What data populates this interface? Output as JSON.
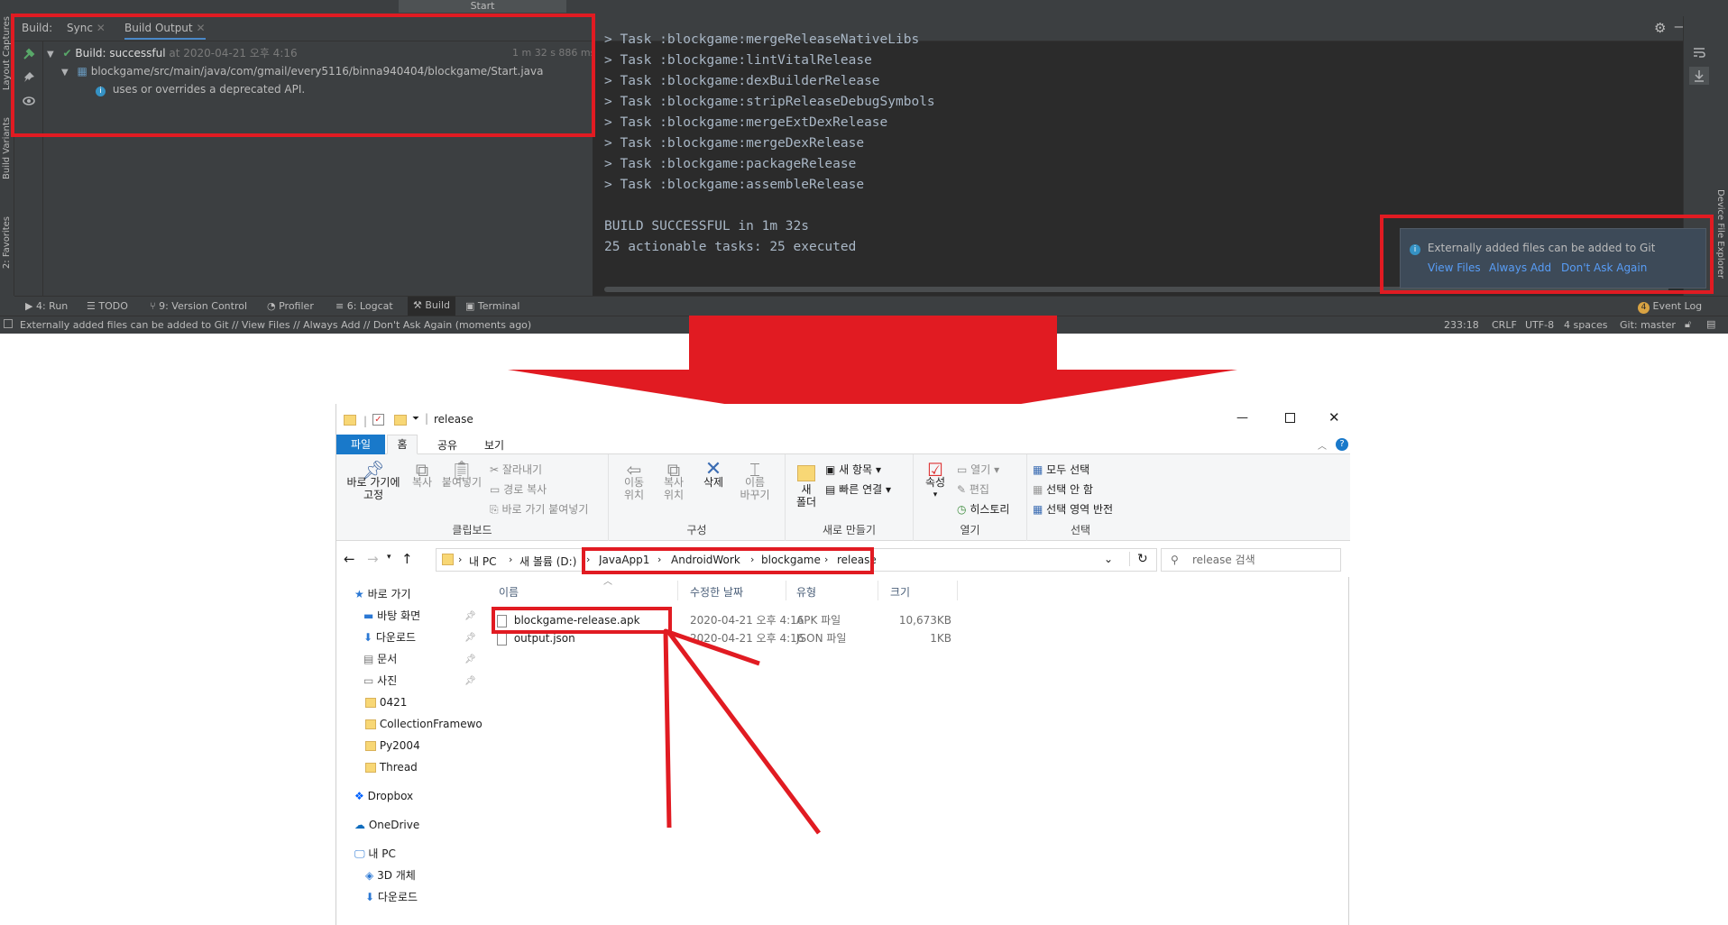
{
  "studio": {
    "start_tab": "Start",
    "left_strip": [
      "Layout Captures",
      "Build Variants",
      "2: Favorites"
    ],
    "right_strip": [
      "Device File Explorer"
    ],
    "build_header": {
      "label": "Build:",
      "tabs": [
        "Sync",
        "Build Output"
      ]
    },
    "tree": {
      "root_label": "Build:",
      "root_status": "successful",
      "root_time": "at 2020-04-21 오후 4:16",
      "duration": "1 m 32 s 886 ms",
      "file": "blockgame/src/main/java/com/gmail/every5116/binna940404/blockgame/Start.java",
      "warning": "uses or overrides a deprecated API."
    },
    "console_lines": [
      "> Task :blockgame:mergeReleaseNativeLibs",
      "> Task :blockgame:lintVitalRelease",
      "> Task :blockgame:dexBuilderRelease",
      "> Task :blockgame:stripReleaseDebugSymbols",
      "> Task :blockgame:mergeExtDexRelease",
      "> Task :blockgame:mergeDexRelease",
      "> Task :blockgame:packageRelease",
      "> Task :blockgame:assembleRelease",
      "",
      "BUILD SUCCESSFUL in 1m 32s",
      "25 actionable tasks: 25 executed"
    ],
    "notification": {
      "message": "Externally added files can be added to Git",
      "actions": [
        "View Files",
        "Always Add",
        "Don't Ask Again"
      ]
    },
    "bottom_tabs": [
      {
        "icon": "run-icon",
        "label": "4: Run"
      },
      {
        "icon": "todo-icon",
        "label": "TODO"
      },
      {
        "icon": "version-control-icon",
        "label": "9: Version Control"
      },
      {
        "icon": "profiler-icon",
        "label": "Profiler"
      },
      {
        "icon": "logcat-icon",
        "label": "6: Logcat"
      },
      {
        "icon": "build-hammer-icon",
        "label": "Build"
      },
      {
        "icon": "terminal-icon",
        "label": "Terminal"
      }
    ],
    "event_log": {
      "count": "4",
      "label": "Event Log"
    },
    "status": {
      "message": "Externally added files can be added to Git // View Files // Always Add // Don't Ask Again (moments ago)",
      "position": "233:18",
      "line_sep": "CRLF",
      "encoding": "UTF-8",
      "indent": "4 spaces",
      "vcs": "Git: master"
    }
  },
  "explorer": {
    "title": "release",
    "ribbon_tabs": [
      "파일",
      "홈",
      "공유",
      "보기"
    ],
    "clipboard": {
      "group": "클립보드",
      "pin_line1": "바로 가기에",
      "pin_line2": "고정",
      "copy": "복사",
      "paste": "붙여넣기",
      "cut": "잘라내기",
      "copy_path": "경로 복사",
      "paste_shortcut": "바로 가기 붙여넣기"
    },
    "organize": {
      "group": "구성",
      "move_l1": "이동",
      "move_l2": "위치",
      "copyto_l1": "복사",
      "copyto_l2": "위치",
      "delete": "삭제",
      "rename_l1": "이름",
      "rename_l2": "바꾸기"
    },
    "new": {
      "group": "새로 만들기",
      "folder_l1": "새",
      "folder_l2": "폴더",
      "new_item": "새 항목",
      "easy_access": "빠른 연결"
    },
    "open": {
      "group": "열기",
      "properties": "속성",
      "open": "열기",
      "edit": "편집",
      "history": "히스토리"
    },
    "select": {
      "group": "선택",
      "all": "모두 선택",
      "none": "선택 안 함",
      "invert": "선택 영역 반전"
    },
    "breadcrumb_pre": [
      "내 PC",
      "새 볼륨 (D:)"
    ],
    "breadcrumb": [
      "JavaApp1",
      "AndroidWork",
      "blockgame",
      "release"
    ],
    "search_placeholder": "release 검색",
    "nav": [
      {
        "icon": "star-icon",
        "label": "바로 가기",
        "pin": false,
        "indent": 0
      },
      {
        "icon": "desktop-icon",
        "label": "바탕 화면",
        "pin": true,
        "indent": 1
      },
      {
        "icon": "download-icon",
        "label": "다운로드",
        "pin": true,
        "indent": 1
      },
      {
        "icon": "document-icon",
        "label": "문서",
        "pin": true,
        "indent": 1
      },
      {
        "icon": "pictures-icon",
        "label": "사진",
        "pin": true,
        "indent": 1
      },
      {
        "icon": "folder-icon",
        "label": "0421",
        "pin": false,
        "indent": 1
      },
      {
        "icon": "folder-icon",
        "label": "CollectionFramewo",
        "pin": false,
        "indent": 1
      },
      {
        "icon": "folder-icon",
        "label": "Py2004",
        "pin": false,
        "indent": 1
      },
      {
        "icon": "folder-icon",
        "label": "Thread",
        "pin": false,
        "indent": 1
      },
      {
        "icon": "dropbox-icon",
        "label": "Dropbox",
        "pin": false,
        "indent": 0
      },
      {
        "icon": "onedrive-icon",
        "label": "OneDrive",
        "pin": false,
        "indent": 0
      },
      {
        "icon": "pc-icon",
        "label": "내 PC",
        "pin": false,
        "indent": 0
      },
      {
        "icon": "cube-icon",
        "label": "3D 개체",
        "pin": false,
        "indent": 1
      },
      {
        "icon": "download-icon",
        "label": "다운로드",
        "pin": false,
        "indent": 1
      }
    ],
    "columns": [
      "이름",
      "수정한 날짜",
      "유형",
      "크기"
    ],
    "files": [
      {
        "name": "blockgame-release.apk",
        "date": "2020-04-21 오후 4:16",
        "type": "APK 파일",
        "size": "10,673KB"
      },
      {
        "name": "output.json",
        "date": "2020-04-21 오후 4:16",
        "type": "JSON 파일",
        "size": "1KB"
      }
    ]
  },
  "colors": {
    "highlight_red": "#e11b22",
    "studio_bg": "#3c3f41",
    "console_bg": "#2b2b2b",
    "success_green": "#59a869",
    "link_blue": "#589df6",
    "explorer_file_tab": "#1979ca"
  }
}
